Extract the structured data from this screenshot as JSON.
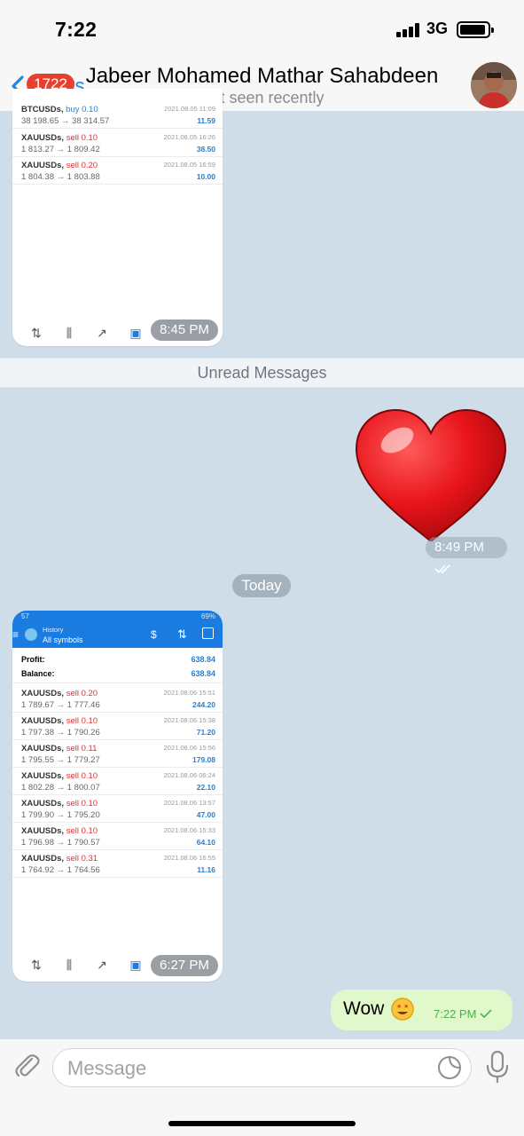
{
  "status_bar": {
    "time": "7:22",
    "network": "3G"
  },
  "header": {
    "back_label": "Chats",
    "unread_count": "1722",
    "title": "Jabeer Mohamed Mathar Sahabdeen",
    "subtitle": "last seen recently"
  },
  "messages": {
    "first_image": {
      "partial_row": {
        "symbol": "BTCUSDs",
        "side": "buy 0.10",
        "price": "38 198.65 → 38 314.57",
        "date": "2021.08.05 11:09",
        "profit": "11.59"
      },
      "rows": [
        {
          "symbol": "XAUUSDs",
          "side": "sell 0.10",
          "price": "1 813.27 → 1 809.42",
          "date": "2021.08.05 16:26",
          "profit": "38.50"
        },
        {
          "symbol": "XAUUSDs",
          "side": "sell 0.20",
          "price": "1 804.38 → 1 803.88",
          "date": "2021.08.05 16:59",
          "profit": "10.00"
        }
      ],
      "time": "8:45 PM"
    },
    "unread_divider": "Unread Messages",
    "heart_message": {
      "time": "8:49 PM",
      "color": "#e8151b"
    },
    "date_divider": "Today",
    "second_image": {
      "phone_status": {
        "time": "57",
        "battery": "69%"
      },
      "app_title": "History",
      "app_subtitle": "All symbols",
      "profit_label": "Profit:",
      "profit_value": "638.84",
      "balance_label": "Balance:",
      "balance_value": "638.84",
      "rows": [
        {
          "symbol": "XAUUSDs",
          "side": "sell 0.20",
          "price": "1 789.67 → 1 777.46",
          "date": "2021.08.06 15:51",
          "profit": "244.20"
        },
        {
          "symbol": "XAUUSDs",
          "side": "sell 0.10",
          "price": "1 797.38 → 1 790.26",
          "date": "2021.08.06 15:38",
          "profit": "71.20"
        },
        {
          "symbol": "XAUUSDs",
          "side": "sell 0.11",
          "price": "1 795.55 → 1 779.27",
          "date": "2021.08.06 15:56",
          "profit": "179.08"
        },
        {
          "symbol": "XAUUSDs",
          "side": "sell 0.10",
          "price": "1 802.28 → 1 800.07",
          "date": "2021.08.06 06:24",
          "profit": "22.10"
        },
        {
          "symbol": "XAUUSDs",
          "side": "sell 0.10",
          "price": "1 799.90 → 1 795.20",
          "date": "2021.08.06 13:57",
          "profit": "47.00"
        },
        {
          "symbol": "XAUUSDs",
          "side": "sell 0.10",
          "price": "1 796.98 → 1 790.57",
          "date": "2021.08.06 15:33",
          "profit": "64.10"
        },
        {
          "symbol": "XAUUSDs",
          "side": "sell 0.31",
          "price": "1 764.92 → 1 764.56",
          "date": "2021.08.06 16:55",
          "profit": "11.16"
        }
      ],
      "time": "6:27 PM"
    },
    "outgoing_text": {
      "text": "Wow",
      "emoji": "star-struck-emoji",
      "time": "7:22 PM"
    }
  },
  "composer": {
    "placeholder": "Message"
  },
  "colors": {
    "accent": "#1e88e5",
    "badge": "#e8402c",
    "outgoing_bubble": "#e1f8cb",
    "chat_background": "#cfdde9"
  }
}
